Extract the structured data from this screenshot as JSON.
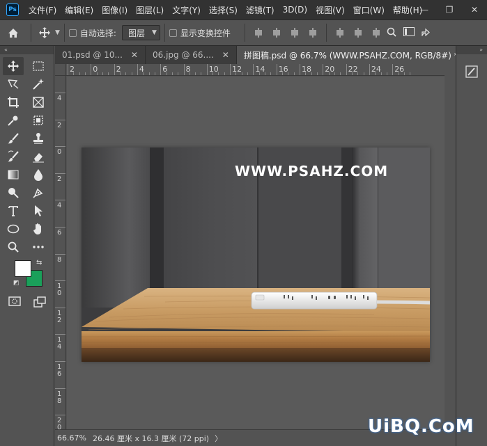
{
  "app": {
    "logo_text": "Ps"
  },
  "menu": [
    "文件(F)",
    "编辑(E)",
    "图像(I)",
    "图层(L)",
    "文字(Y)",
    "选择(S)",
    "滤镜(T)",
    "3D(D)",
    "视图(V)",
    "窗口(W)",
    "帮助(H)"
  ],
  "window_controls": {
    "minimize": "—",
    "restore": "❐",
    "close": "✕"
  },
  "options_bar": {
    "home_icon": "home-icon",
    "move_icon": "move-icon",
    "auto_select_label": "自动选择:",
    "auto_select_checked": false,
    "target_value": "图层",
    "show_transform_label": "显示变换控件",
    "show_transform_checked": false
  },
  "tabs": [
    {
      "label": "01.psd @ 10...",
      "active": false
    },
    {
      "label": "06.jpg @ 66....",
      "active": false
    },
    {
      "label": "拼图稿.psd @ 66.7% (WWW.PSAHZ.COM, RGB/8#) *",
      "active": true
    }
  ],
  "ruler_h": [
    "2",
    "0",
    "2",
    "4",
    "6",
    "8",
    "10",
    "12",
    "14",
    "16",
    "18",
    "20",
    "22",
    "24",
    "26"
  ],
  "ruler_v": [
    "4",
    "2",
    "0",
    "2",
    "4",
    "6",
    "8",
    "10",
    "12",
    "14",
    "16",
    "18",
    "20"
  ],
  "canvas": {
    "watermark_text": "WWW.PSAHZ.COM"
  },
  "colors": {
    "foreground": "#ffffff",
    "background": "#1aa05a"
  },
  "statusbar": {
    "zoom": "66.67%",
    "doc_info": "26.46 厘米 x 16.3 厘米 (72 ppi)",
    "arrow": "〉"
  },
  "site_watermark": "UiBQ.CoM",
  "toolbar_collapse": "«",
  "right_collapse": "»"
}
